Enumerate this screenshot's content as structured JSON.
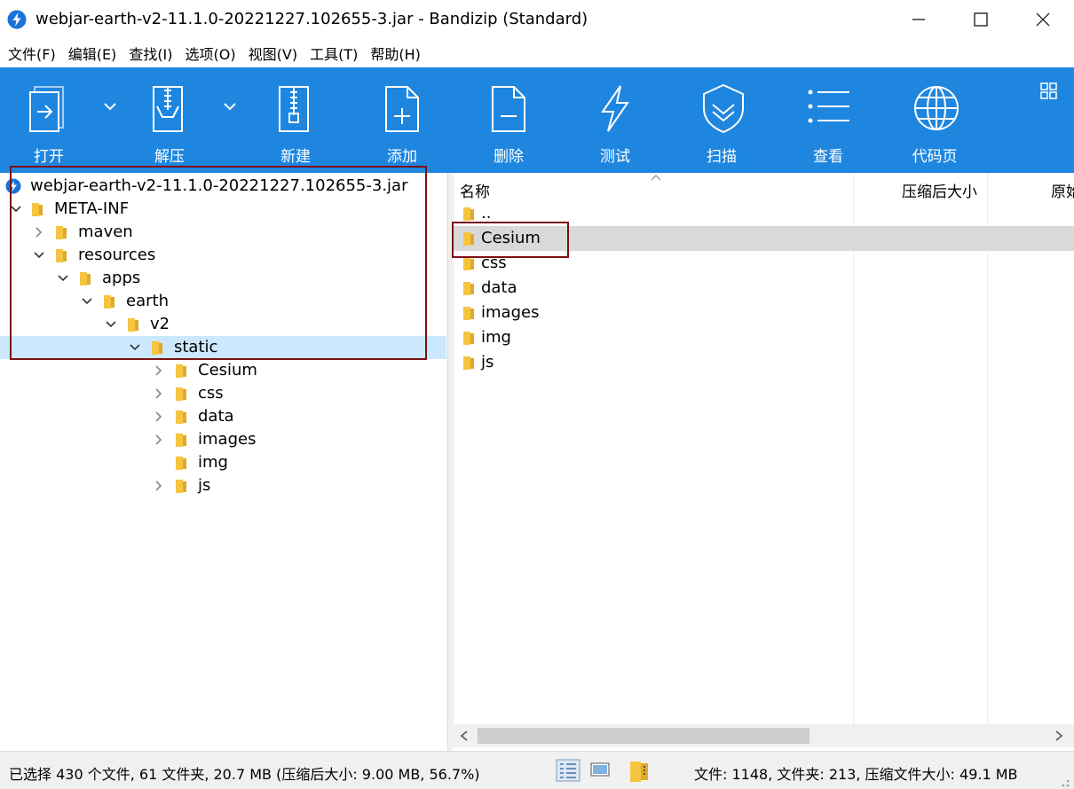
{
  "window": {
    "title": "webjar-earth-v2-11.1.0-20221227.102655-3.jar - Bandizip (Standard)"
  },
  "menu": [
    "文件(F)",
    "编辑(E)",
    "查找(I)",
    "选项(O)",
    "视图(V)",
    "工具(T)",
    "帮助(H)"
  ],
  "toolbar": {
    "open": "打开",
    "extract": "解压",
    "new": "新建",
    "add": "添加",
    "delete": "删除",
    "test": "测试",
    "scan": "扫描",
    "view": "查看",
    "codepage": "代码页"
  },
  "tree": [
    {
      "label": "webjar-earth-v2-11.1.0-20221227.102655-3.jar"
    },
    {
      "label": "META-INF"
    },
    {
      "label": "maven"
    },
    {
      "label": "resources"
    },
    {
      "label": "apps"
    },
    {
      "label": "earth"
    },
    {
      "label": "v2"
    },
    {
      "label": "static"
    },
    {
      "label": "Cesium"
    },
    {
      "label": "css"
    },
    {
      "label": "data"
    },
    {
      "label": "images"
    },
    {
      "label": "img"
    },
    {
      "label": "js"
    }
  ],
  "list": {
    "columns": {
      "name": "名称",
      "compressed_size": "压缩后大小",
      "original_size": "原始"
    },
    "rows": [
      "..",
      "Cesium",
      "css",
      "data",
      "images",
      "img",
      "js"
    ]
  },
  "status": {
    "left": "已选择 430 个文件, 61 文件夹, 20.7 MB (压缩后大小: 9.00 MB, 56.7%)",
    "right": "文件: 1148, 文件夹: 213, 压缩文件大小: 49.1 MB"
  },
  "colors": {
    "toolbar": "#1f86e0",
    "selection": "#cce8ff",
    "highlight_row": "#d9d9d9",
    "annotation_box": "#7b1113",
    "folder": "#f5c542"
  }
}
